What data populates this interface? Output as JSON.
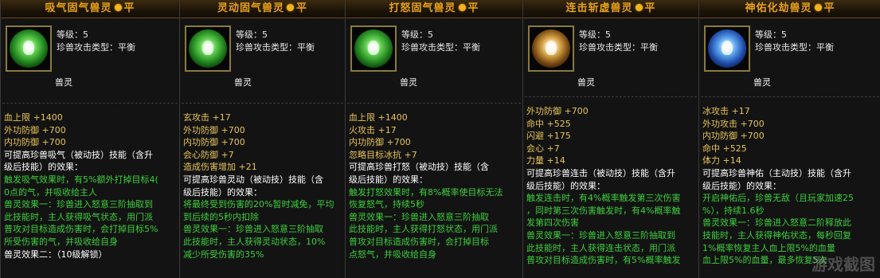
{
  "panels": [
    {
      "title": "吸气固气兽灵",
      "quality": "平",
      "orb": "green",
      "level": "等级：5",
      "type": "珍兽攻击类型：平衡",
      "sub": "兽灵",
      "lines": [
        {
          "c": "v",
          "t": "血上限 +1400"
        },
        {
          "c": "v",
          "t": "外功防御 +700"
        },
        {
          "c": "v",
          "t": "内功防御 +700"
        },
        {
          "c": "w",
          "t": "可提高珍兽吸气（被动技）技能（含升"
        },
        {
          "c": "w",
          "t": "级后技能）的效果："
        },
        {
          "c": "g",
          "t": "触发吸气效果时，有5%额外打掉目标4("
        },
        {
          "c": "g",
          "t": "0点的气，并吸收给主人"
        },
        {
          "c": "g",
          "t": "兽灵效果一：珍兽进入怒意三阶抽取到"
        },
        {
          "c": "g",
          "t": "此技能时，主人获得吸气状态，用门派"
        },
        {
          "c": "g",
          "t": "普攻对目标造成伤害时，会打掉目标5%"
        },
        {
          "c": "g",
          "t": "所受伤害的气，并吸收给自身"
        },
        {
          "c": "w",
          "t": "兽灵效果二：（10级解锁）"
        }
      ]
    },
    {
      "title": "灵动固气兽灵",
      "quality": "平",
      "orb": "green",
      "level": "等级：5",
      "type": "珍兽攻击类型：平衡",
      "sub": "兽灵",
      "lines": [
        {
          "c": "v",
          "t": "玄攻击 +17"
        },
        {
          "c": "v",
          "t": "外功防御 +700"
        },
        {
          "c": "v",
          "t": "内功防御 +700"
        },
        {
          "c": "v",
          "t": "会心防御 +7"
        },
        {
          "c": "v",
          "t": "造成伤害增加 +21"
        },
        {
          "c": "w",
          "t": "可提高珍兽灵动（被动技）技能（含"
        },
        {
          "c": "w",
          "t": "级后技能）的效果："
        },
        {
          "c": "g",
          "t": "将最终受到伤害的20%暂时减免，平均"
        },
        {
          "c": "g",
          "t": "到后续的5秒内扣除"
        },
        {
          "c": "g",
          "t": "兽灵效果一：珍兽进入怒意三阶抽取"
        },
        {
          "c": "g",
          "t": "此技能时，主人获得灵动状态，10%"
        },
        {
          "c": "g",
          "t": "减少所受伤害的35%"
        }
      ]
    },
    {
      "title": "打怒固气兽灵",
      "quality": "平",
      "orb": "green",
      "level": "等级：5",
      "type": "珍兽攻击类型：平衡",
      "sub": "兽灵",
      "lines": [
        {
          "c": "v",
          "t": "血上限 +1400"
        },
        {
          "c": "v",
          "t": "火攻击 +17"
        },
        {
          "c": "v",
          "t": "内功防御 +700"
        },
        {
          "c": "v",
          "t": "忽略目标冰抗 +7"
        },
        {
          "c": "w",
          "t": "可提高珍兽打怒（被动技）技能（含"
        },
        {
          "c": "w",
          "t": "级后技能）的效果："
        },
        {
          "c": "g",
          "t": "触发打怒效果时，有8%概率使目标无法"
        },
        {
          "c": "g",
          "t": "恢复怒气，持续5秒"
        },
        {
          "c": "g",
          "t": "兽灵效果一：珍兽进入怒意三阶抽取"
        },
        {
          "c": "g",
          "t": "此技能时，主人获得打怒状态，用门派"
        },
        {
          "c": "g",
          "t": "普攻对目标造成伤害时，会打掉目标"
        },
        {
          "c": "g",
          "t": "点怒气，并吸收给自身"
        }
      ]
    },
    {
      "title": "连击斩虚兽灵",
      "quality": "平",
      "orb": "gold",
      "level": "等级：5",
      "type": "珍兽攻击类型：平衡",
      "sub": "兽灵",
      "lines": [
        {
          "c": "v",
          "t": "外功防御 +700"
        },
        {
          "c": "v",
          "t": "命中 +525"
        },
        {
          "c": "v",
          "t": "闪避 +175"
        },
        {
          "c": "v",
          "t": "会心 +7"
        },
        {
          "c": "v",
          "t": "力量 +14"
        },
        {
          "c": "w",
          "t": "可提高珍兽连击（被动技）技能（含升"
        },
        {
          "c": "w",
          "t": "级后技能）的效果："
        },
        {
          "c": "g",
          "t": "触发连击时，有4%概率触发第三次伤害"
        },
        {
          "c": "g",
          "t": "，同时第三次伤害触发时，有4%概率触"
        },
        {
          "c": "g",
          "t": "发第四次伤害"
        },
        {
          "c": "g",
          "t": "兽灵效果一：珍兽进入怒意三阶抽取到"
        },
        {
          "c": "g",
          "t": "此技能时，主人获得连击状态，用门派"
        },
        {
          "c": "g",
          "t": "普攻对目标造成伤害时，有5%概率触发"
        }
      ]
    },
    {
      "title": "神佑化劫兽灵",
      "quality": "平",
      "orb": "blue",
      "level": "等级：5",
      "type": "珍兽攻击类型：平衡",
      "sub": "兽灵",
      "lines": [
        {
          "c": "v",
          "t": "冰攻击 +17"
        },
        {
          "c": "v",
          "t": "外功攻击 +700"
        },
        {
          "c": "v",
          "t": "内功防御 +700"
        },
        {
          "c": "v",
          "t": "命中 +525"
        },
        {
          "c": "v",
          "t": "体力 +14"
        },
        {
          "c": "w",
          "t": "可提高珍兽神佑（主动技）技能（含升"
        },
        {
          "c": "w",
          "t": "级后技能）的效果："
        },
        {
          "c": "g",
          "t": "开启神佑后，珍兽无敌（且玩家加速25"
        },
        {
          "c": "g",
          "t": "%），持续1.6秒"
        },
        {
          "c": "g",
          "t": "兽灵效果一：珍兽进入怒意二阶释放此"
        },
        {
          "c": "g",
          "t": "技能时，主人获得神佑状态，每秒回复"
        },
        {
          "c": "g",
          "t": "1%概率恢复主人血上限5%的血量"
        },
        {
          "c": "g",
          "t": "血上限5%的血量，最多恢复5次"
        }
      ]
    }
  ],
  "watermark": "游戏截图"
}
